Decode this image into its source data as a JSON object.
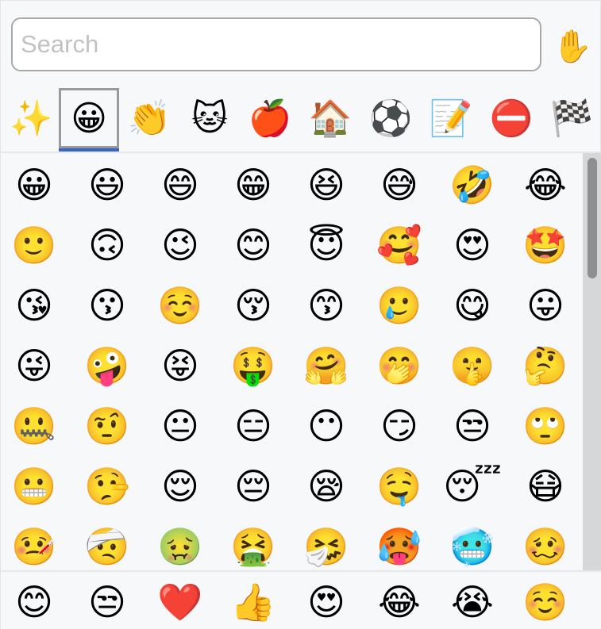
{
  "search": {
    "placeholder": "Search",
    "value": ""
  },
  "skin_tone": {
    "glyph": "✋",
    "icon": "raised-hand-icon"
  },
  "categories": [
    {
      "glyph": "✨",
      "icon": "sparkles-icon",
      "name": "frequent"
    },
    {
      "glyph": "😀",
      "icon": "grinning-face-icon",
      "name": "smileys",
      "selected": true
    },
    {
      "glyph": "👏",
      "icon": "waving-hands-icon",
      "name": "people"
    },
    {
      "glyph": "🐱",
      "icon": "cat-face-icon",
      "name": "animals"
    },
    {
      "glyph": "🍎",
      "icon": "apple-icon",
      "name": "food"
    },
    {
      "glyph": "🏠",
      "icon": "house-icon",
      "name": "places"
    },
    {
      "glyph": "⚽",
      "icon": "soccer-ball-icon",
      "name": "activities"
    },
    {
      "glyph": "📝",
      "icon": "memo-icon",
      "name": "objects"
    },
    {
      "glyph": "⛔",
      "icon": "no-entry-icon",
      "name": "symbols"
    },
    {
      "glyph": "🏁",
      "icon": "checkered-flag-icon",
      "name": "flags"
    }
  ],
  "grid": [
    [
      "😀",
      "😃",
      "😄",
      "😁",
      "😆",
      "😅",
      "🤣",
      "😂"
    ],
    [
      "🙂",
      "🙃",
      "😉",
      "😊",
      "😇",
      "🥰",
      "😍",
      "🤩"
    ],
    [
      "😘",
      "😗",
      "☺️",
      "😚",
      "😙",
      "🥲",
      "😋",
      "😛"
    ],
    [
      "😜",
      "🤪",
      "😝",
      "🤑",
      "🤗",
      "🤭",
      "🤫",
      "🤔"
    ],
    [
      "🤐",
      "🤨",
      "😐",
      "😑",
      "😶",
      "😏",
      "😒",
      "🙄"
    ],
    [
      "😬",
      "🤥",
      "😌",
      "😔",
      "😪",
      "🤤",
      "😴",
      "😷"
    ],
    [
      "🤒",
      "🤕",
      "🤢",
      "🤮",
      "🤧",
      "🥵",
      "🥶",
      "🥴"
    ]
  ],
  "recent": [
    "😊",
    "😒",
    "❤️",
    "👍",
    "😍",
    "😂",
    "😭",
    "☺️"
  ],
  "colors": {
    "accent": "#3a64c8",
    "scroll_thumb": "#8e8f91",
    "scroll_track": "#d6d7d9"
  }
}
